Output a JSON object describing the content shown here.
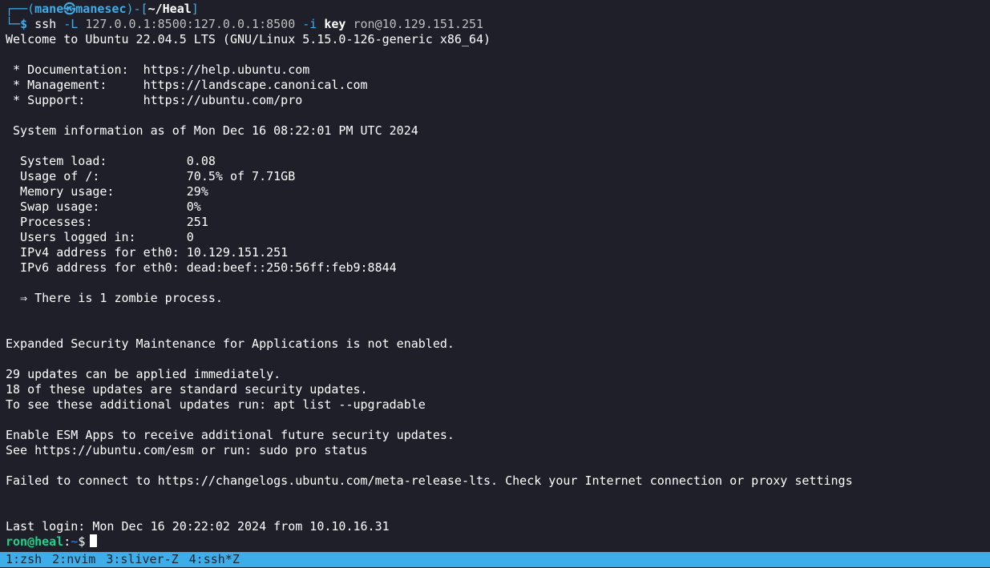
{
  "prompt": {
    "corner_top": "┌──",
    "open_paren": "(",
    "user": "mane",
    "skull": "㉿",
    "host": "manesec",
    "close_paren_bracket": ")-[",
    "cwd": "~/Heal",
    "close_bracket": "]",
    "corner_bottom": "└─",
    "dollar": "$"
  },
  "command": {
    "program": "ssh",
    "flag_L": "-L",
    "forward": "127.0.0.1:8500:127.0.0.1:8500",
    "flag_i": "-i",
    "keyfile": "key",
    "target": "ron@10.129.151.251"
  },
  "output": {
    "welcome": "Welcome to Ubuntu 22.04.5 LTS (GNU/Linux 5.15.0-126-generic x86_64)",
    "doc_line": " * Documentation:  https://help.ubuntu.com",
    "mgmt_line": " * Management:     https://landscape.canonical.com",
    "support_line": " * Support:        https://ubuntu.com/pro",
    "sysinfo_header": " System information as of Mon Dec 16 08:22:01 PM UTC 2024",
    "stats": [
      {
        "label": "  System load:           ",
        "value": "0.08"
      },
      {
        "label": "  Usage of /:            ",
        "value": "70.5% of 7.71GB"
      },
      {
        "label": "  Memory usage:          ",
        "value": "29%"
      },
      {
        "label": "  Swap usage:            ",
        "value": "0%"
      },
      {
        "label": "  Processes:             ",
        "value": "251"
      },
      {
        "label": "  Users logged in:       ",
        "value": "0"
      },
      {
        "label": "  IPv4 address for eth0: ",
        "value": "10.129.151.251"
      },
      {
        "label": "  IPv6 address for eth0: ",
        "value": "dead:beef::250:56ff:feb9:8844"
      }
    ],
    "zombie": "  ⇒ There is 1 zombie process.",
    "esm_apps": "Expanded Security Maintenance for Applications is not enabled.",
    "updates_1": "29 updates can be applied immediately.",
    "updates_2": "18 of these updates are standard security updates.",
    "updates_3": "To see these additional updates run: apt list --upgradable",
    "esm_enable": "Enable ESM Apps to receive additional future security updates.",
    "esm_see": "See https://ubuntu.com/esm or run: sudo pro status",
    "failed": "Failed to connect to https://changelogs.ubuntu.com/meta-release-lts. Check your Internet connection or proxy settings",
    "last_login": "Last login: Mon Dec 16 20:22:02 2024 from 10.10.16.31"
  },
  "remote_prompt": {
    "userhost": "ron@heal",
    "colon": ":",
    "dir": "~",
    "dollar": "$"
  },
  "statusbar": {
    "windows": [
      "1:zsh",
      "2:nvim",
      "3:sliver-Z",
      "4:ssh*Z"
    ]
  },
  "colors": {
    "background": "#1e1f29",
    "accent": "#3daee9",
    "prompt_green": "#23d18b"
  }
}
